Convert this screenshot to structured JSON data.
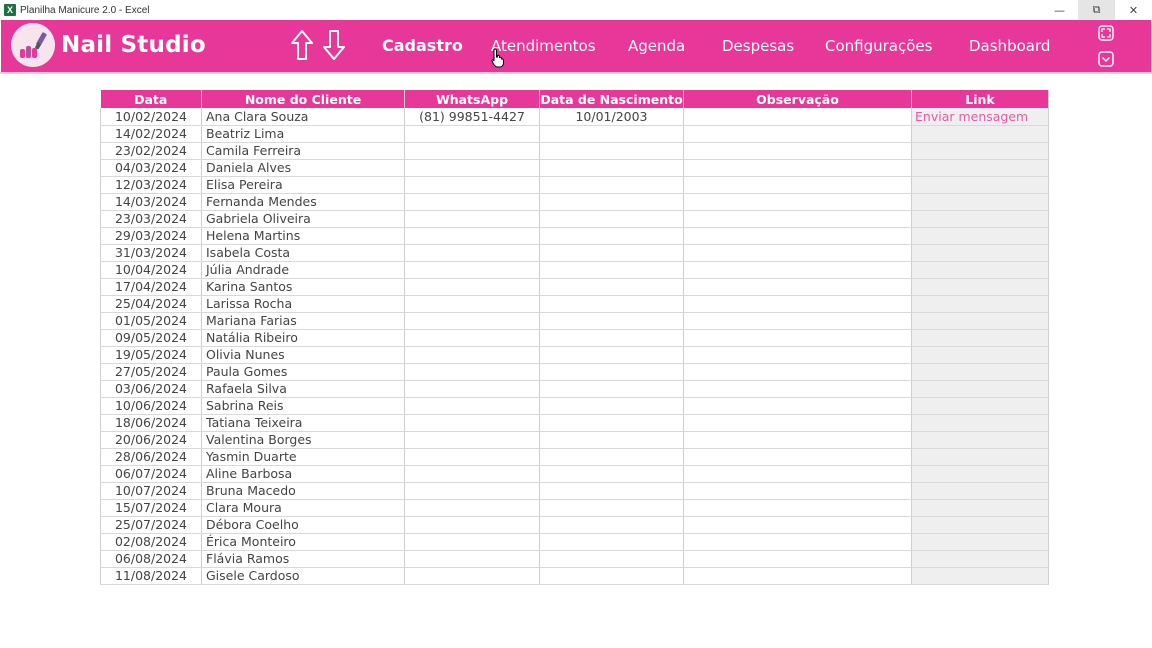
{
  "window": {
    "title": "Planilha Manicure 2.0 - Excel",
    "app_icon_letter": "X",
    "controls": {
      "minimize": "—",
      "restore": "⧉",
      "close": "✕"
    }
  },
  "header": {
    "brand": "Nail Studio",
    "nav": [
      "Cadastro",
      "Atendimentos",
      "Agenda",
      "Despesas",
      "Configurações",
      "Dashboard"
    ],
    "active_nav": "Cadastro",
    "accent_color": "#e7389a"
  },
  "table": {
    "columns": [
      "Data",
      "Nome do Cliente",
      "WhatsApp",
      "Data de Nascimento",
      "Observação",
      "Link"
    ],
    "rows": [
      [
        "10/02/2024",
        "Ana Clara Souza",
        "(81) 99851-4427",
        "10/01/2003",
        "",
        "Enviar mensagem"
      ],
      [
        "14/02/2024",
        "Beatriz Lima",
        "",
        "",
        "",
        ""
      ],
      [
        "23/02/2024",
        "Camila Ferreira",
        "",
        "",
        "",
        ""
      ],
      [
        "04/03/2024",
        "Daniela Alves",
        "",
        "",
        "",
        ""
      ],
      [
        "12/03/2024",
        "Elisa Pereira",
        "",
        "",
        "",
        ""
      ],
      [
        "14/03/2024",
        "Fernanda Mendes",
        "",
        "",
        "",
        ""
      ],
      [
        "23/03/2024",
        "Gabriela Oliveira",
        "",
        "",
        "",
        ""
      ],
      [
        "29/03/2024",
        "Helena Martins",
        "",
        "",
        "",
        ""
      ],
      [
        "31/03/2024",
        "Isabela Costa",
        "",
        "",
        "",
        ""
      ],
      [
        "10/04/2024",
        "Júlia Andrade",
        "",
        "",
        "",
        ""
      ],
      [
        "17/04/2024",
        "Karina Santos",
        "",
        "",
        "",
        ""
      ],
      [
        "25/04/2024",
        "Larissa Rocha",
        "",
        "",
        "",
        ""
      ],
      [
        "01/05/2024",
        "Mariana Farias",
        "",
        "",
        "",
        ""
      ],
      [
        "09/05/2024",
        "Natália Ribeiro",
        "",
        "",
        "",
        ""
      ],
      [
        "19/05/2024",
        "Olivia Nunes",
        "",
        "",
        "",
        ""
      ],
      [
        "27/05/2024",
        "Paula Gomes",
        "",
        "",
        "",
        ""
      ],
      [
        "03/06/2024",
        "Rafaela Silva",
        "",
        "",
        "",
        ""
      ],
      [
        "10/06/2024",
        "Sabrina Reis",
        "",
        "",
        "",
        ""
      ],
      [
        "18/06/2024",
        "Tatiana Teixeira",
        "",
        "",
        "",
        ""
      ],
      [
        "20/06/2024",
        "Valentina Borges",
        "",
        "",
        "",
        ""
      ],
      [
        "28/06/2024",
        "Yasmin Duarte",
        "",
        "",
        "",
        ""
      ],
      [
        "06/07/2024",
        "Aline Barbosa",
        "",
        "",
        "",
        ""
      ],
      [
        "10/07/2024",
        "Bruna Macedo",
        "",
        "",
        "",
        ""
      ],
      [
        "15/07/2024",
        "Clara Moura",
        "",
        "",
        "",
        ""
      ],
      [
        "25/07/2024",
        "Débora Coelho",
        "",
        "",
        "",
        ""
      ],
      [
        "02/08/2024",
        "Érica Monteiro",
        "",
        "",
        "",
        ""
      ],
      [
        "06/08/2024",
        "Flávia Ramos",
        "",
        "",
        "",
        ""
      ],
      [
        "11/08/2024",
        "Gisele Cardoso",
        "",
        "",
        "",
        ""
      ]
    ]
  }
}
